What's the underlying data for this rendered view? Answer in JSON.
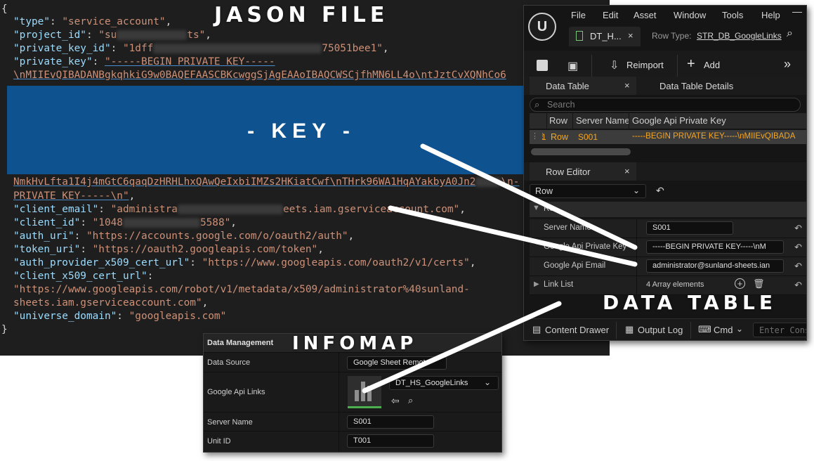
{
  "overlays": {
    "json_title": "JASON FILE",
    "key_label": "- KEY -",
    "data_table_title": "DATA TABLE",
    "infomap_title": "INFOMAP"
  },
  "json_editor": {
    "open_brace": "{",
    "close_brace": "}",
    "lines": {
      "type_key": "\"type\"",
      "type_val": "\"service_account\"",
      "project_key": "\"project_id\"",
      "project_val_a": "\"su",
      "project_val_b": "ts\"",
      "pkid_key": "\"private_key_id\"",
      "pkid_val_a": "\"1dff",
      "pkid_val_b": "75051bee1\"",
      "pk_key": "\"private_key\"",
      "pk_val_a": "\"-----BEGIN PRIVATE KEY-----",
      "pk_line2": "\\nMIIEvQIBADANBgkqhkiG9w0BAQEFAASCBKcwggSjAgEAAoIBAQCWSCjfhMN6LL4o\\ntJztCvXQNhCo6",
      "pk_line3": "NmkHvLfta1I4j4mGtC6qaqDzHRHLhxQAwQeIxbiIMZs2HKiatCwf\\nTHrk96WA1HqAYakbyA0Jn2",
      "pk_line3_tail": "\\n-",
      "pk_line4": "PRIVATE KEY-----\\n\"",
      "email_key": "\"client_email\"",
      "email_val_a": "\"administra",
      "email_val_b": "eets.iam.gserviceaccount.com\"",
      "cid_key": "\"client_id\"",
      "cid_val_a": "\"1048",
      "cid_val_b": "5588\"",
      "auth_key": "\"auth_uri\"",
      "auth_val": "\"https://accounts.google.com/o/oauth2/auth\"",
      "token_key": "\"token_uri\"",
      "token_val": "\"https://oauth2.googleapis.com/token\"",
      "prov_key": "\"auth_provider_x509_cert_url\"",
      "prov_val": "\"https://www.googleapis.com/oauth2/v1/certs\"",
      "cert_key": "\"client_x509_cert_url\"",
      "cert_val_1": "\"https://www.googleapis.com/robot/v1/metadata/x509/administrator%40sunland-",
      "cert_val_2": "sheets.iam.gserviceaccount.com\"",
      "uni_key": "\"universe_domain\"",
      "uni_val": "\"googleapis.com\""
    }
  },
  "ue": {
    "menu": [
      "File",
      "Edit",
      "Asset",
      "Window",
      "Tools",
      "Help"
    ],
    "asset_tab": "DT_H...",
    "row_type_label": "Row Type:",
    "row_type_value": "STR_DB_GoogleLinks",
    "toolbar": {
      "reimport": "Reimport",
      "add": "Add"
    },
    "tabs": {
      "data_table": "Data Table",
      "details": "Data Table Details",
      "row_editor": "Row Editor"
    },
    "search_placeholder": "Search",
    "columns": [
      "Row",
      "Server Name",
      "Google Api Private Key"
    ],
    "row": {
      "index": "1",
      "name": "Row",
      "server": "S001",
      "key": "-----BEGIN PRIVATE KEY-----\\nMIIEvQIBADA"
    },
    "row_editor": {
      "selected": "Row",
      "category": "Ro",
      "fields": [
        {
          "label": "Server Name",
          "value": "S001"
        },
        {
          "label": "Google Api Private Key",
          "value": "-----BEGIN PRIVATE KEY-----\\nM"
        },
        {
          "label": "Google Api Email",
          "value": "administrator@sunland-sheets.ian"
        },
        {
          "label": "Link List",
          "value": "4 Array elements"
        }
      ]
    },
    "status": {
      "content_drawer": "Content Drawer",
      "output_log": "Output Log",
      "cmd": "Cmd",
      "console_placeholder": "Enter Cons"
    }
  },
  "infomap": {
    "header": "Data Management",
    "rows": [
      {
        "label": "Data Source",
        "value": "Google Sheet Remote"
      },
      {
        "label": "Google Api Links",
        "value": "DT_HS_GoogleLinks"
      },
      {
        "label": "Server Name",
        "value": "S001"
      },
      {
        "label": "Unit ID",
        "value": "T001"
      }
    ]
  },
  "colors": {
    "key_band": "#0e5390",
    "accent_orange": "#f5a623",
    "json_key": "#9cdcfe",
    "json_string": "#ce9178"
  }
}
